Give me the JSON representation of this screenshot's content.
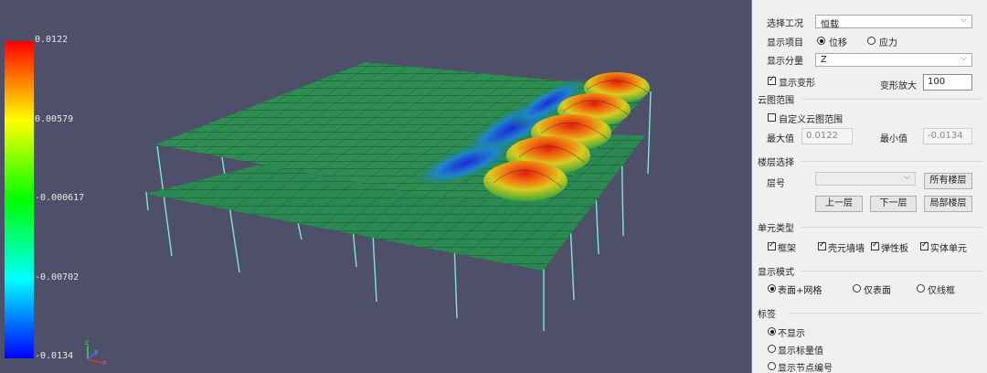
{
  "legend": {
    "ticks": [
      "0.0122",
      "0.00579",
      "-0.000617",
      "-0.00702",
      "-0.0134"
    ],
    "colors": [
      "#ff0000",
      "#ffff00",
      "#00ff00",
      "#00ffff",
      "#0000ff"
    ]
  },
  "axes": {
    "x": "x",
    "y": "y",
    "z": "z"
  },
  "panel": {
    "load_case": {
      "label": "选择工况",
      "value": "恒载"
    },
    "display_item": {
      "label": "显示项目",
      "options": [
        "位移",
        "应力"
      ],
      "selected": "位移"
    },
    "component": {
      "label": "显示分量",
      "value": "Z"
    },
    "deform": {
      "checkbox_label": "显示变形",
      "checked": true,
      "scale_label": "变形放大",
      "scale_value": "100"
    },
    "contour": {
      "title": "云图范围",
      "custom_label": "自定义云图范围",
      "custom_checked": false,
      "max_label": "最大值",
      "max_value": "0.0122",
      "min_label": "最小值",
      "min_value": "-0.0134"
    },
    "floor": {
      "title": "楼层选择",
      "floor_label": "层号",
      "floor_value": "",
      "all_button": "所有楼层",
      "up_button": "上一层",
      "down_button": "下一层",
      "local_button": "局部楼层"
    },
    "element_type": {
      "title": "单元类型",
      "items": [
        {
          "label": "框架",
          "checked": true
        },
        {
          "label": "壳元墙墙",
          "checked": true
        },
        {
          "label": "弹性板",
          "checked": true
        },
        {
          "label": "实体单元",
          "checked": true
        }
      ]
    },
    "display_mode": {
      "title": "显示模式",
      "options": [
        "表面+网格",
        "仅表面",
        "仅线框"
      ],
      "selected": "表面+网格"
    },
    "labels": {
      "title": "标签",
      "options": [
        "不显示",
        "显示标量值",
        "显示节点编号"
      ],
      "selected": "不显示"
    }
  }
}
